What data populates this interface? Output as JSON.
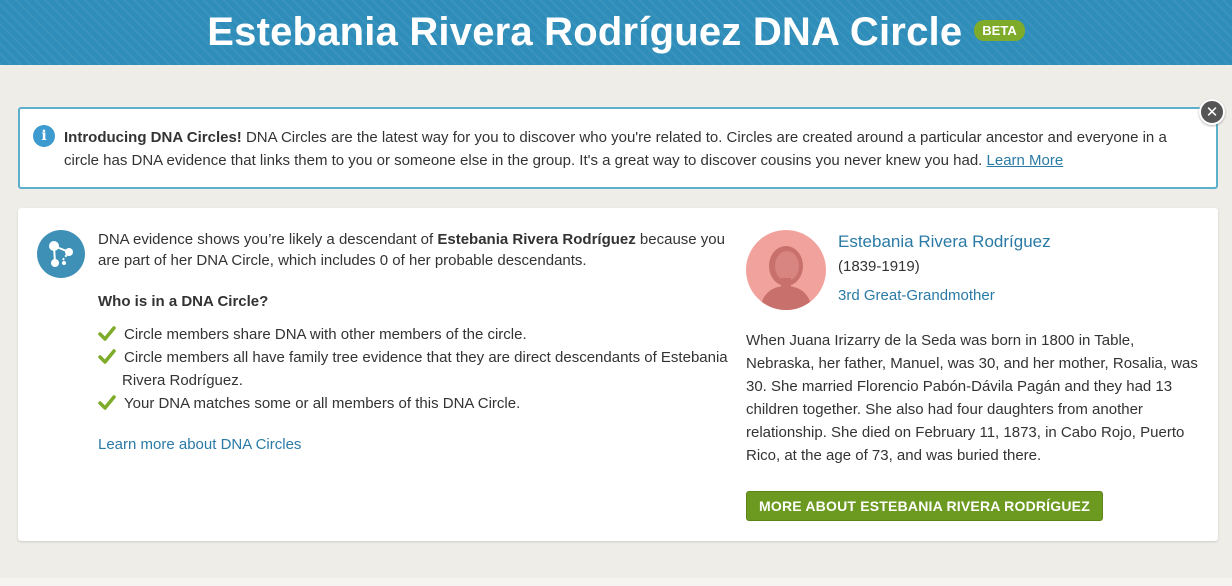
{
  "header": {
    "title": "Estebania Rivera Rodríguez DNA Circle",
    "badge": "BETA"
  },
  "intro_banner": {
    "heading": "Introducing DNA Circles!",
    "text": " DNA Circles are the latest way for you to discover who you're related to. Circles are created around a particular ancestor and everyone in a circle has DNA evidence that links them to you or someone else in the group. It's a great way to discover cousins you never knew you had. ",
    "link_label": "Learn More",
    "info_icon": "info-icon",
    "close_icon": "close-icon"
  },
  "evidence": {
    "prefix": "DNA evidence shows you’re likely a descendant of ",
    "ancestor": "Estebania Rivera Rodríguez",
    "suffix": " because you are part of her DNA Circle, which includes 0 of her probable descendants.",
    "who_title": "Who is in a DNA Circle?",
    "points": [
      "Circle members share DNA with other members of the circle.",
      "Circle members all have family tree evidence that they are direct descendants of Estebania",
      "Rivera Rodríguez.",
      "Your DNA matches some or all members of this DNA Circle."
    ],
    "learn_more_label": "Learn more about DNA Circles"
  },
  "person": {
    "name": "Estebania Rivera Rodríguez",
    "dates": "(1839-1919)",
    "relationship": "3rd Great-Grandmother",
    "bio": "When Juana Irizarry de la Seda was born in 1800 in Table, Nebraska, her father, Manuel, was 30, and her mother, Rosalia, was 30. She married Florencio Pabón-Dávila Pagán and they had 13 children together. She also had four daughters from another relationship. She died on February 11, 1873, in Cabo Rojo, Puerto Rico, at the age of 73, and was buried there.",
    "button_label": "MORE ABOUT ESTEBANIA RIVERA RODRÍGUEZ"
  },
  "colors": {
    "header_blue": "#2f8db9",
    "link_blue": "#2a7aa6",
    "check_green": "#7eac2a",
    "button_green": "#6c9a21",
    "avatar_pink": "#f2a29c"
  }
}
